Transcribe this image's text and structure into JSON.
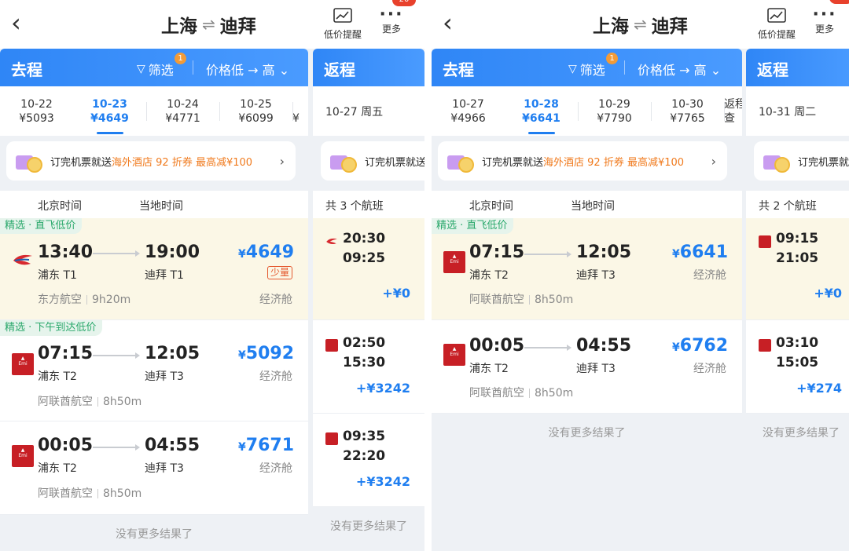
{
  "panels": [
    {
      "route_from": "上海",
      "route_to": "迪拜",
      "alert_label": "低价提醒",
      "more_label": "更多",
      "badge": "20",
      "outbound": {
        "title": "去程",
        "filter_label": "筛选",
        "filter_count": "1",
        "sort_label": "价格低 → 高",
        "dates": [
          {
            "date": "10-22",
            "price": "¥5093"
          },
          {
            "date": "10-23",
            "price": "¥4649"
          },
          {
            "date": "10-24",
            "price": "¥4771"
          },
          {
            "date": "10-25",
            "price": "¥6099"
          }
        ],
        "date_edge": "¥",
        "promo_prefix": "订完机票就送",
        "promo_highlight": "海外酒店 92 折券 最高减¥100",
        "time_head_1": "北京时间",
        "time_head_2": "当地时间",
        "flights": [
          {
            "tag": "精选 · 直飞低价",
            "dep": "13:40",
            "arr": "19:00",
            "dep_apt": "浦东 T1",
            "arr_apt": "迪拜 T1",
            "price": "4649",
            "note": "少量",
            "airline": "东方航空",
            "duration": "9h20m",
            "cabin": "经济舱"
          },
          {
            "tag": "精选 · 下午到达低价",
            "dep": "07:15",
            "arr": "12:05",
            "dep_apt": "浦东 T2",
            "arr_apt": "迪拜 T3",
            "price": "5092",
            "airline": "阿联酋航空",
            "duration": "8h50m",
            "cabin": "经济舱"
          },
          {
            "dep": "00:05",
            "arr": "04:55",
            "dep_apt": "浦东 T2",
            "arr_apt": "迪拜 T3",
            "price": "7671",
            "airline": "阿联酋航空",
            "duration": "8h50m",
            "cabin": "经济舱"
          }
        ],
        "no_more": "没有更多结果了"
      },
      "return": {
        "title": "返程",
        "date": "10-27 周五",
        "promo_prefix": "订完机票就送",
        "count": "共 3 个航班",
        "flights": [
          {
            "dep": "20:30",
            "arr": "09:25",
            "price": "+¥0"
          },
          {
            "dep": "02:50",
            "arr": "15:30",
            "price": "+¥3242"
          },
          {
            "dep": "09:35",
            "arr": "22:20",
            "price": "+¥3242"
          }
        ],
        "no_more": "没有更多结果了"
      }
    },
    {
      "route_from": "上海",
      "route_to": "迪拜",
      "alert_label": "低价提醒",
      "more_label": "更多",
      "outbound": {
        "title": "去程",
        "filter_label": "筛选",
        "filter_count": "1",
        "sort_label": "价格低 → 高",
        "dates": [
          {
            "date": "10-27",
            "price": "¥4966"
          },
          {
            "date": "10-28",
            "price": "¥6641"
          },
          {
            "date": "10-29",
            "price": "¥7790"
          },
          {
            "date": "10-30",
            "price": "¥7765"
          }
        ],
        "date_edge": "返程",
        "date_edge_2": "查",
        "promo_prefix": "订完机票就送",
        "promo_highlight": "海外酒店 92 折券 最高减¥100",
        "time_head_1": "北京时间",
        "time_head_2": "当地时间",
        "flights": [
          {
            "tag": "精选 · 直飞低价",
            "dep": "07:15",
            "arr": "12:05",
            "dep_apt": "浦东 T2",
            "arr_apt": "迪拜 T3",
            "price": "6641",
            "airline": "阿联酋航空",
            "duration": "8h50m",
            "cabin": "经济舱"
          },
          {
            "dep": "00:05",
            "arr": "04:55",
            "dep_apt": "浦东 T2",
            "arr_apt": "迪拜 T3",
            "price": "6762",
            "airline": "阿联酋航空",
            "duration": "8h50m",
            "cabin": "经济舱"
          }
        ],
        "no_more": "没有更多结果了"
      },
      "return": {
        "title": "返程",
        "date": "10-31 周二",
        "promo_prefix": "订完机票就",
        "count": "共 2 个航班",
        "flights": [
          {
            "dep": "09:15",
            "arr": "21:05",
            "price": "+¥0"
          },
          {
            "dep": "03:10",
            "arr": "15:05",
            "price": "+¥274"
          }
        ],
        "no_more": "没有更多结果了"
      }
    }
  ]
}
